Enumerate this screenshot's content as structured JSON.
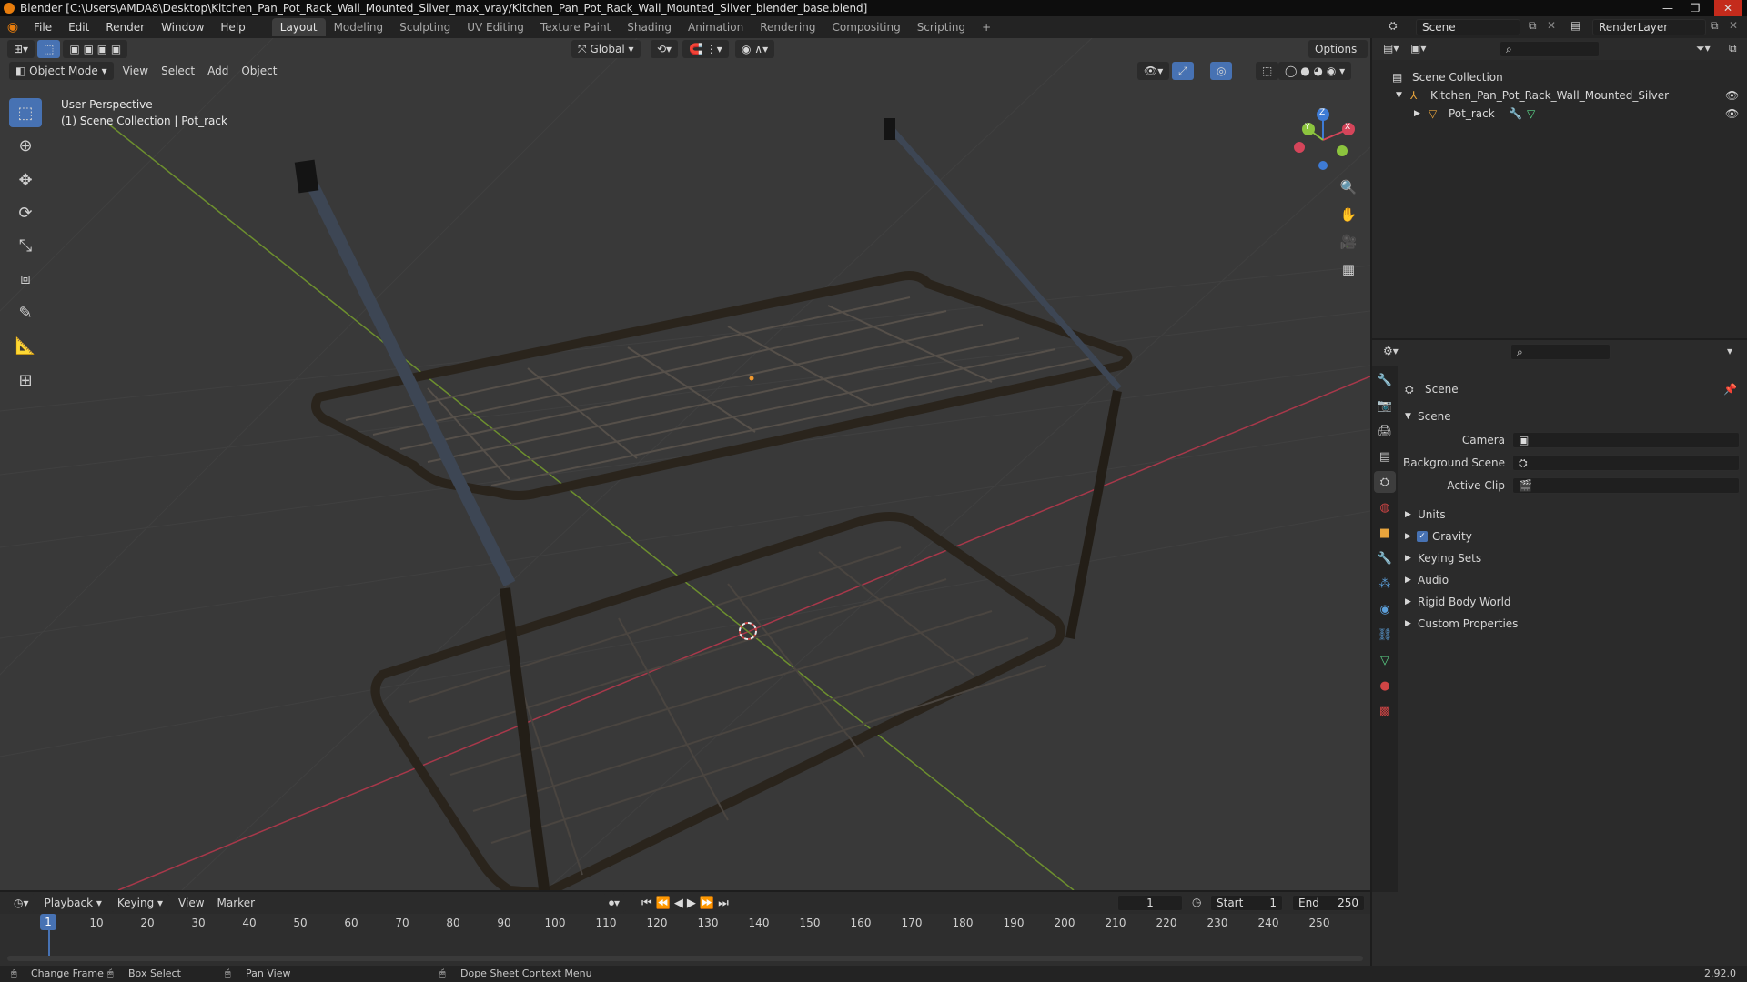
{
  "title_bar": {
    "title": "Blender [C:\\Users\\AMDA8\\Desktop\\Kitchen_Pan_Pot_Rack_Wall_Mounted_Silver_max_vray/Kitchen_Pan_Pot_Rack_Wall_Mounted_Silver_blender_base.blend]",
    "minimize": "—",
    "maximize": "❐",
    "close": "✕"
  },
  "menu": {
    "items": [
      "File",
      "Edit",
      "Render",
      "Window",
      "Help"
    ],
    "workspaces": [
      "Layout",
      "Modeling",
      "Sculpting",
      "UV Editing",
      "Texture Paint",
      "Shading",
      "Animation",
      "Rendering",
      "Compositing",
      "Scripting"
    ],
    "active_workspace": "Layout",
    "add_workspace": "+",
    "scene_label": "Scene",
    "renderlayer_label": "RenderLayer"
  },
  "viewport_header": {
    "transform_orientation": "Global",
    "options": "Options",
    "mode": "Object Mode",
    "view": "View",
    "select": "Select",
    "add": "Add",
    "object": "Object"
  },
  "viewport_overlay": {
    "perspective": "User Perspective",
    "collection_info": "(1) Scene Collection | Pot_rack"
  },
  "gizmo": {
    "z": "Z",
    "x": "X",
    "y": "Y"
  },
  "outliner": {
    "root": "Scene Collection",
    "items": [
      {
        "name": "Kitchen_Pan_Pot_Rack_Wall_Mounted_Silver"
      },
      {
        "name": "Pot_rack"
      }
    ]
  },
  "properties": {
    "context_title": "Scene",
    "panel_title": "Scene",
    "fields": [
      {
        "label": "Camera"
      },
      {
        "label": "Background Scene"
      },
      {
        "label": "Active Clip"
      }
    ],
    "sections": [
      "Units",
      "Gravity",
      "Keying Sets",
      "Audio",
      "Rigid Body World",
      "Custom Properties"
    ],
    "gravity_checked": true
  },
  "timeline": {
    "playback": "Playback",
    "keying": "Keying",
    "view": "View",
    "marker": "Marker",
    "current_frame": "1",
    "start_label": "Start",
    "start_value": "1",
    "end_label": "End",
    "end_value": "250",
    "ticks": [
      "10",
      "20",
      "30",
      "40",
      "50",
      "60",
      "70",
      "80",
      "90",
      "100",
      "110",
      "120",
      "130",
      "140",
      "150",
      "160",
      "170",
      "180",
      "190",
      "200",
      "210",
      "220",
      "230",
      "240",
      "250"
    ],
    "playhead": "1"
  },
  "status_bar": {
    "change_frame": "Change Frame",
    "box_select": "Box Select",
    "pan_view": "Pan View",
    "context_menu": "Dope Sheet Context Menu",
    "version": "2.92.0"
  },
  "colors": {
    "accent": "#4772b3",
    "x_axis": "#d5455a",
    "y_axis": "#8cc43e",
    "z_axis": "#3e7bd5",
    "viewport_bg": "#393939"
  }
}
